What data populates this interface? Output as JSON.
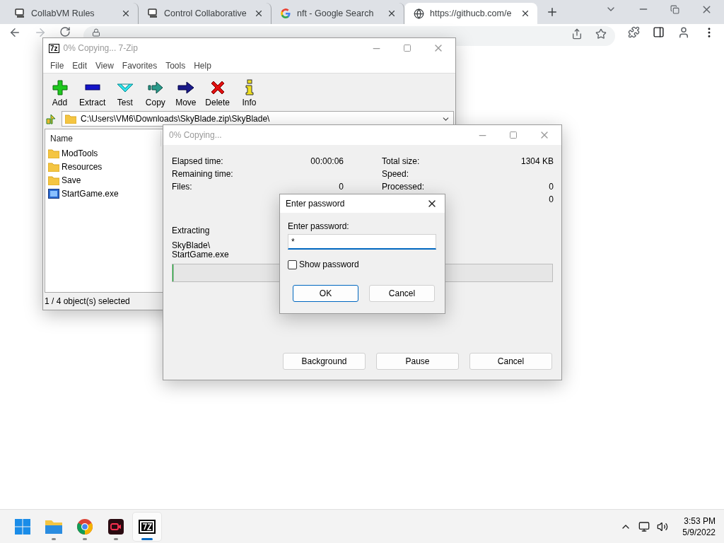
{
  "browser": {
    "tabs": [
      {
        "title": "CollabVM Rules",
        "selected": false
      },
      {
        "title": "Control Collaborative",
        "selected": false
      },
      {
        "title": "nft - Google Search",
        "selected": false
      },
      {
        "title": "https://githucb.com/e",
        "selected": true
      }
    ]
  },
  "zip_window": {
    "title": "0% Copying... 7-Zip",
    "logo": "7z",
    "menu": [
      "File",
      "Edit",
      "View",
      "Favorites",
      "Tools",
      "Help"
    ],
    "toolbar": [
      "Add",
      "Extract",
      "Test",
      "Copy",
      "Move",
      "Delete",
      "Info"
    ],
    "path": "C:\\Users\\VM6\\Downloads\\SkyBlade.zip\\SkyBlade\\",
    "column": "Name",
    "files": [
      {
        "name": "ModTools",
        "kind": "folder"
      },
      {
        "name": "Resources",
        "kind": "folder"
      },
      {
        "name": "Save",
        "kind": "folder"
      },
      {
        "name": "StartGame.exe",
        "kind": "exe"
      }
    ],
    "status": "1 / 4 object(s) selected"
  },
  "progress_window": {
    "title": "0% Copying...",
    "left_stats": [
      {
        "label": "Elapsed time:",
        "value": "00:00:06"
      },
      {
        "label": "Remaining time:"
      },
      {
        "label": "Files:",
        "value": "0"
      }
    ],
    "right_stats": [
      {
        "label": "Total size:",
        "value": "1304 KB"
      },
      {
        "label": "Speed:"
      },
      {
        "label": "Processed:",
        "value": "0"
      },
      {
        "value": "0"
      }
    ],
    "action": "Extracting",
    "current_file": [
      "SkyBlade\\",
      "StartGame.exe"
    ],
    "progress": {
      "level": 0
    },
    "buttons": [
      "Background",
      "Pause",
      "Cancel"
    ]
  },
  "password_dialog": {
    "title": "Enter password",
    "label": "Enter password:",
    "value": "*",
    "show_password": {
      "label": "Show password",
      "checked": false
    },
    "buttons": [
      {
        "label": "OK",
        "default": true
      },
      {
        "label": "Cancel",
        "default": false
      }
    ]
  },
  "taskbar": {
    "apps": [
      {
        "running": false,
        "selected": false
      },
      {
        "running": true,
        "selected": false
      },
      {
        "running": true,
        "selected": false
      },
      {
        "running": true,
        "selected": false
      },
      {
        "running": true,
        "selected": true
      }
    ],
    "time": "3:53 PM",
    "date": "5/9/2022"
  }
}
